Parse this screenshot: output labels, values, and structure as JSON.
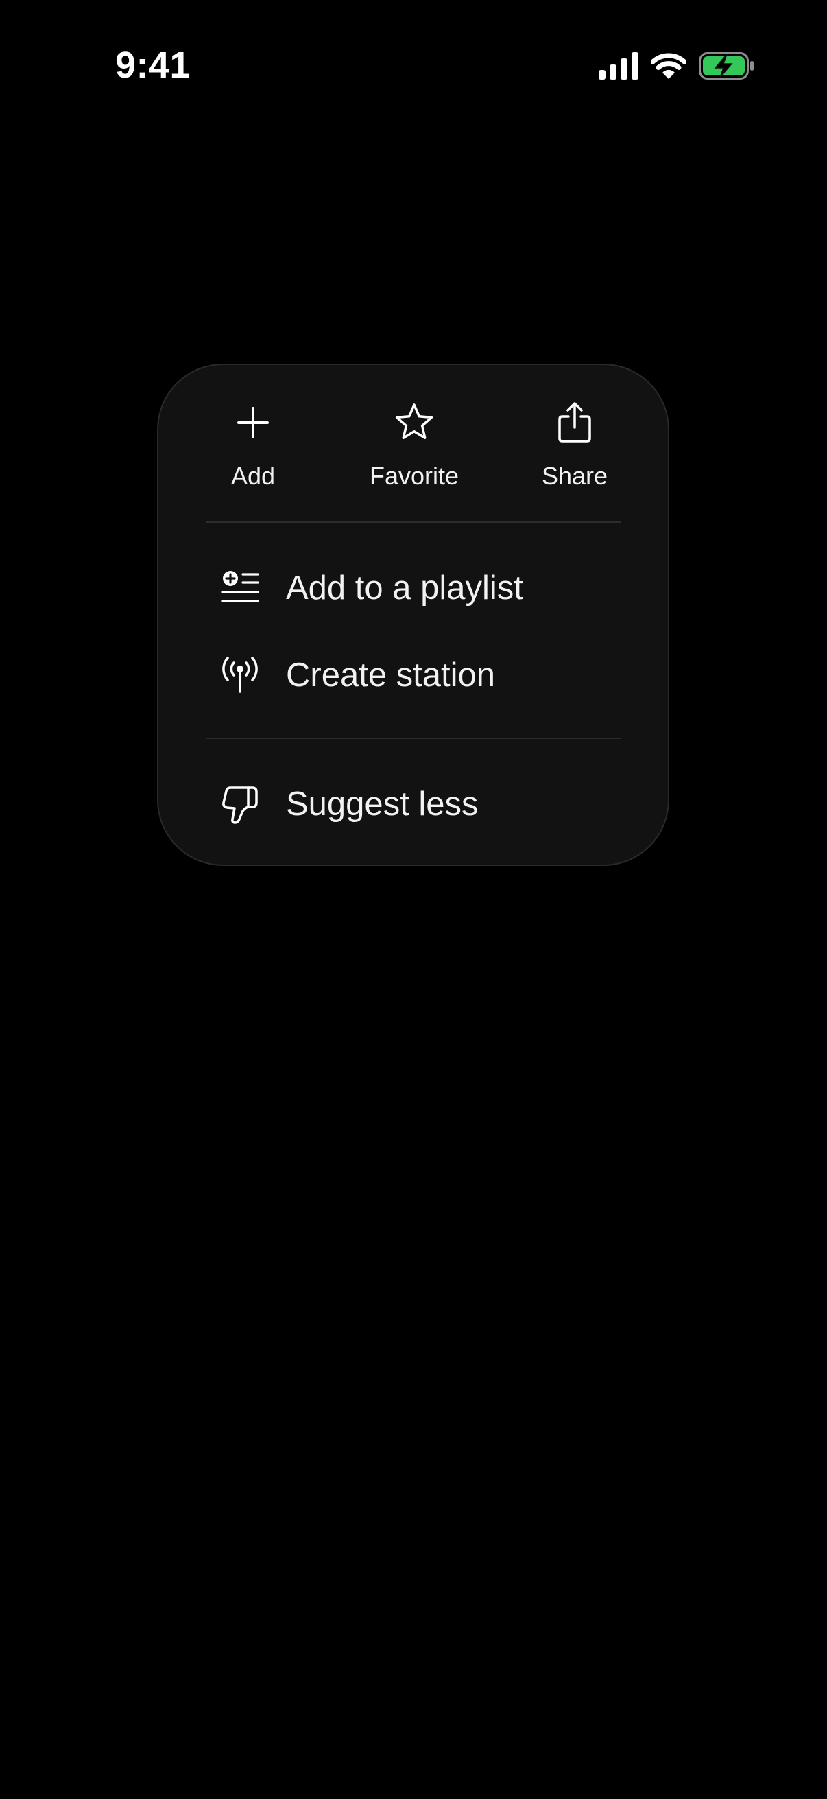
{
  "status_bar": {
    "time": "9:41",
    "icons": [
      "cellular-signal-icon",
      "wifi-icon",
      "battery-charging-icon"
    ],
    "battery_color": "#34c759"
  },
  "menu": {
    "quick_actions": [
      {
        "label": "Add",
        "icon": "plus-icon"
      },
      {
        "label": "Favorite",
        "icon": "star-icon"
      },
      {
        "label": "Share",
        "icon": "share-icon"
      }
    ],
    "items": [
      {
        "label": "Add to a playlist",
        "icon": "add-to-playlist-icon"
      },
      {
        "label": "Create station",
        "icon": "radio-station-icon"
      },
      {
        "label": "Suggest less",
        "icon": "thumbs-down-icon"
      }
    ],
    "background_color": "#121212",
    "text_color": "#ffffff"
  }
}
